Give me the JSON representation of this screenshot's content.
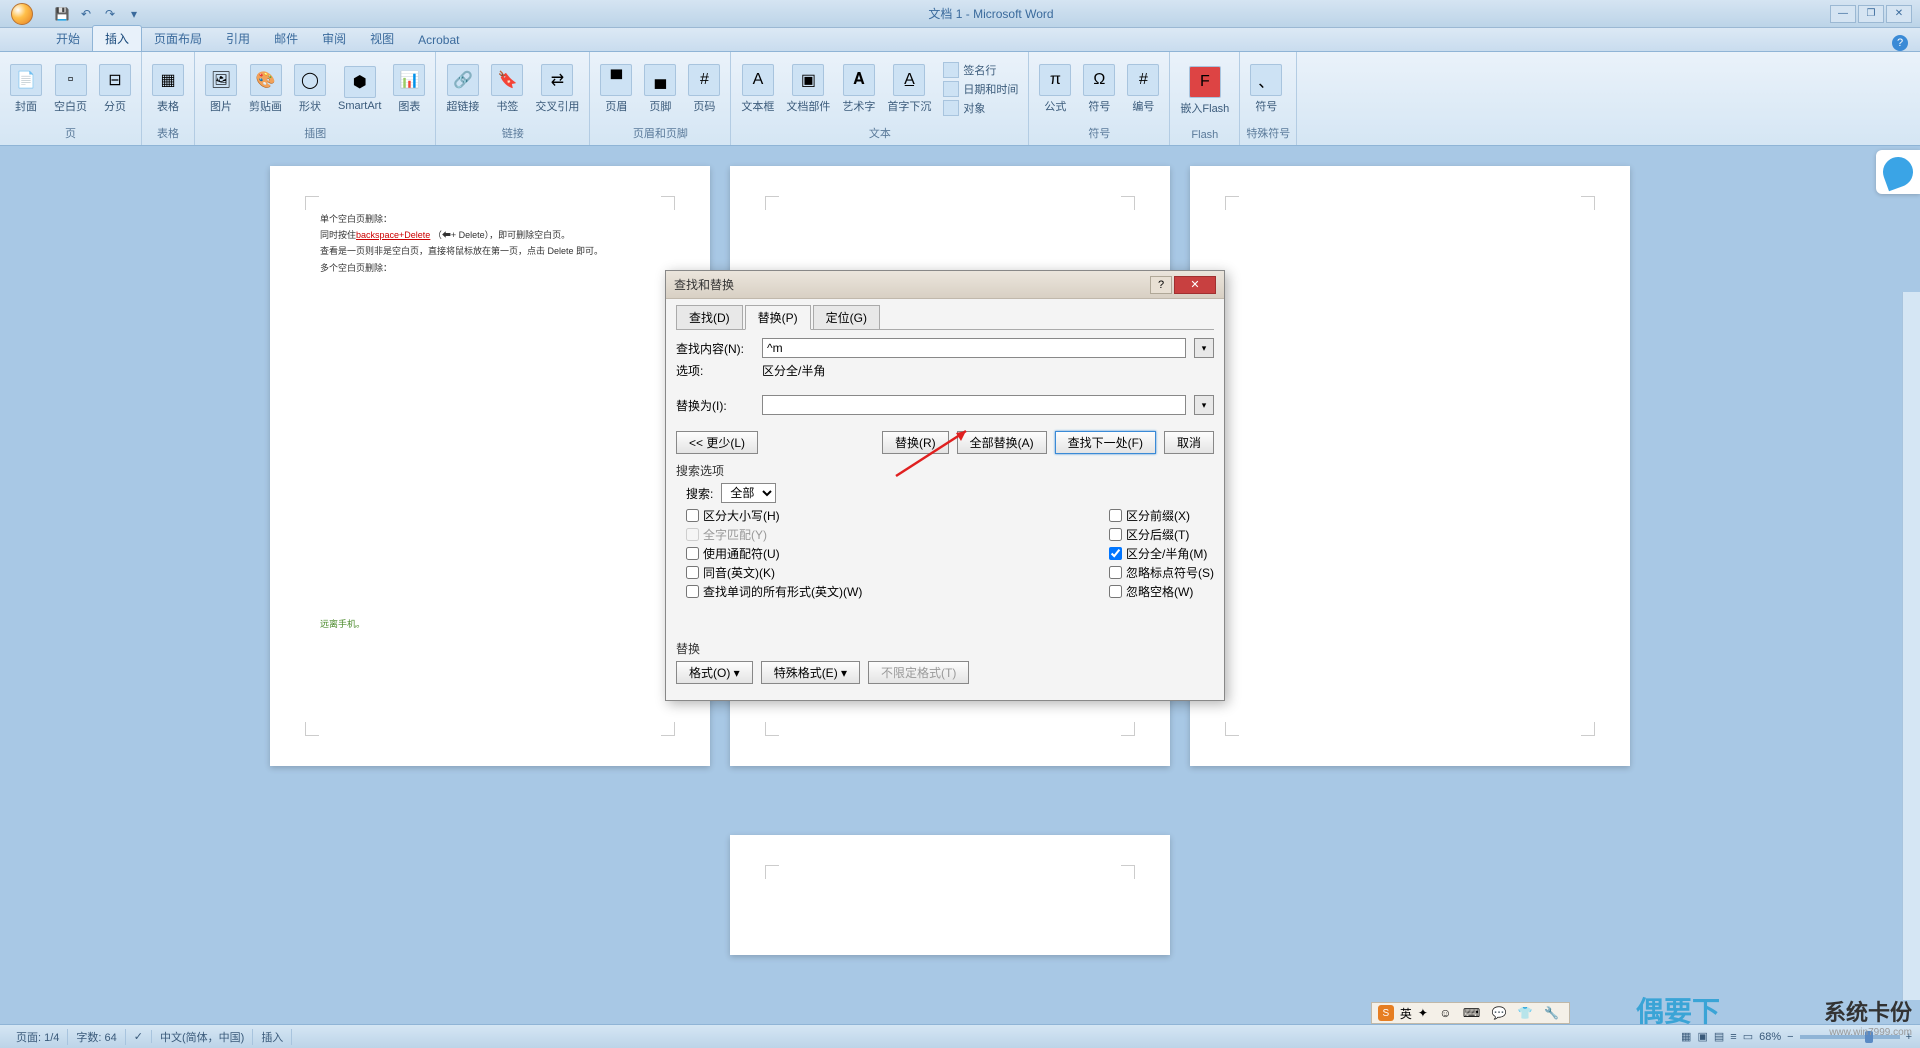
{
  "title": "文档 1 - Microsoft Word",
  "tabs": [
    "开始",
    "插入",
    "页面布局",
    "引用",
    "邮件",
    "审阅",
    "视图",
    "Acrobat"
  ],
  "active_tab": 1,
  "ribbon_groups": {
    "page": {
      "label": "页",
      "items": [
        "封面",
        "空白页",
        "分页"
      ]
    },
    "table": {
      "label": "表格",
      "items": [
        "表格"
      ]
    },
    "illustration": {
      "label": "插图",
      "items": [
        "图片",
        "剪贴画",
        "形状",
        "SmartArt",
        "图表"
      ]
    },
    "link": {
      "label": "链接",
      "items": [
        "超链接",
        "书签",
        "交叉引用"
      ]
    },
    "header_footer": {
      "label": "页眉和页脚",
      "items": [
        "页眉",
        "页脚",
        "页码"
      ]
    },
    "text": {
      "label": "文本",
      "items": [
        "文本框",
        "文档部件",
        "艺术字",
        "首字下沉"
      ],
      "small": [
        "签名行",
        "日期和时间",
        "对象"
      ]
    },
    "symbol": {
      "label": "符号",
      "items": [
        "公式",
        "符号",
        "编号"
      ]
    },
    "flash": {
      "label": "Flash",
      "items": [
        "嵌入Flash"
      ]
    },
    "special": {
      "label": "特殊符号",
      "items": [
        "符号"
      ]
    }
  },
  "document": {
    "line1": "单个空白页删除：",
    "line2_pre": "同时按住",
    "line2_link": "backspace+Delete",
    "line2_post": "（⬅+ Delete），即可删除空白页。",
    "line3": "查看是一页则非是空白页，直接将鼠标放在第一页，点击 Delete 即可。",
    "line4": "多个空白页删除：",
    "green": "远离手机。"
  },
  "dialog": {
    "title": "查找和替换",
    "tabs": [
      "查找(D)",
      "替换(P)",
      "定位(G)"
    ],
    "active_tab": 1,
    "find_label": "查找内容(N):",
    "find_value": "^m",
    "options_label": "选项:",
    "options_value": "区分全/半角",
    "replace_label": "替换为(I):",
    "replace_value": "",
    "btn_less": "<< 更少(L)",
    "btn_replace": "替换(R)",
    "btn_replace_all": "全部替换(A)",
    "btn_find_next": "查找下一处(F)",
    "btn_cancel": "取消",
    "search_options_label": "搜索选项",
    "search_label": "搜索:",
    "search_value": "全部",
    "checks_left": [
      {
        "label": "区分大小写(H)",
        "checked": false,
        "disabled": false
      },
      {
        "label": "全字匹配(Y)",
        "checked": false,
        "disabled": true
      },
      {
        "label": "使用通配符(U)",
        "checked": false,
        "disabled": false
      },
      {
        "label": "同音(英文)(K)",
        "checked": false,
        "disabled": false
      },
      {
        "label": "查找单词的所有形式(英文)(W)",
        "checked": false,
        "disabled": false
      }
    ],
    "checks_right": [
      {
        "label": "区分前缀(X)",
        "checked": false,
        "disabled": false
      },
      {
        "label": "区分后缀(T)",
        "checked": false,
        "disabled": false
      },
      {
        "label": "区分全/半角(M)",
        "checked": true,
        "disabled": false
      },
      {
        "label": "忽略标点符号(S)",
        "checked": false,
        "disabled": false
      },
      {
        "label": "忽略空格(W)",
        "checked": false,
        "disabled": false
      }
    ],
    "replace_section": "替换",
    "btn_format": "格式(O)",
    "btn_special": "特殊格式(E)",
    "btn_noformat": "不限定格式(T)"
  },
  "statusbar": {
    "page": "页面: 1/4",
    "words": "字数: 64",
    "lang": "中文(简体，中国)",
    "mode": "插入",
    "zoom": "68%"
  },
  "sogou": {
    "label": "英",
    "icons": "✦ ☺ ⌨ 💬 👕 🔧"
  },
  "watermark_left": "偶要下",
  "watermark_right": {
    "title": "系统卡份",
    "sub": "www.win7999.com"
  }
}
